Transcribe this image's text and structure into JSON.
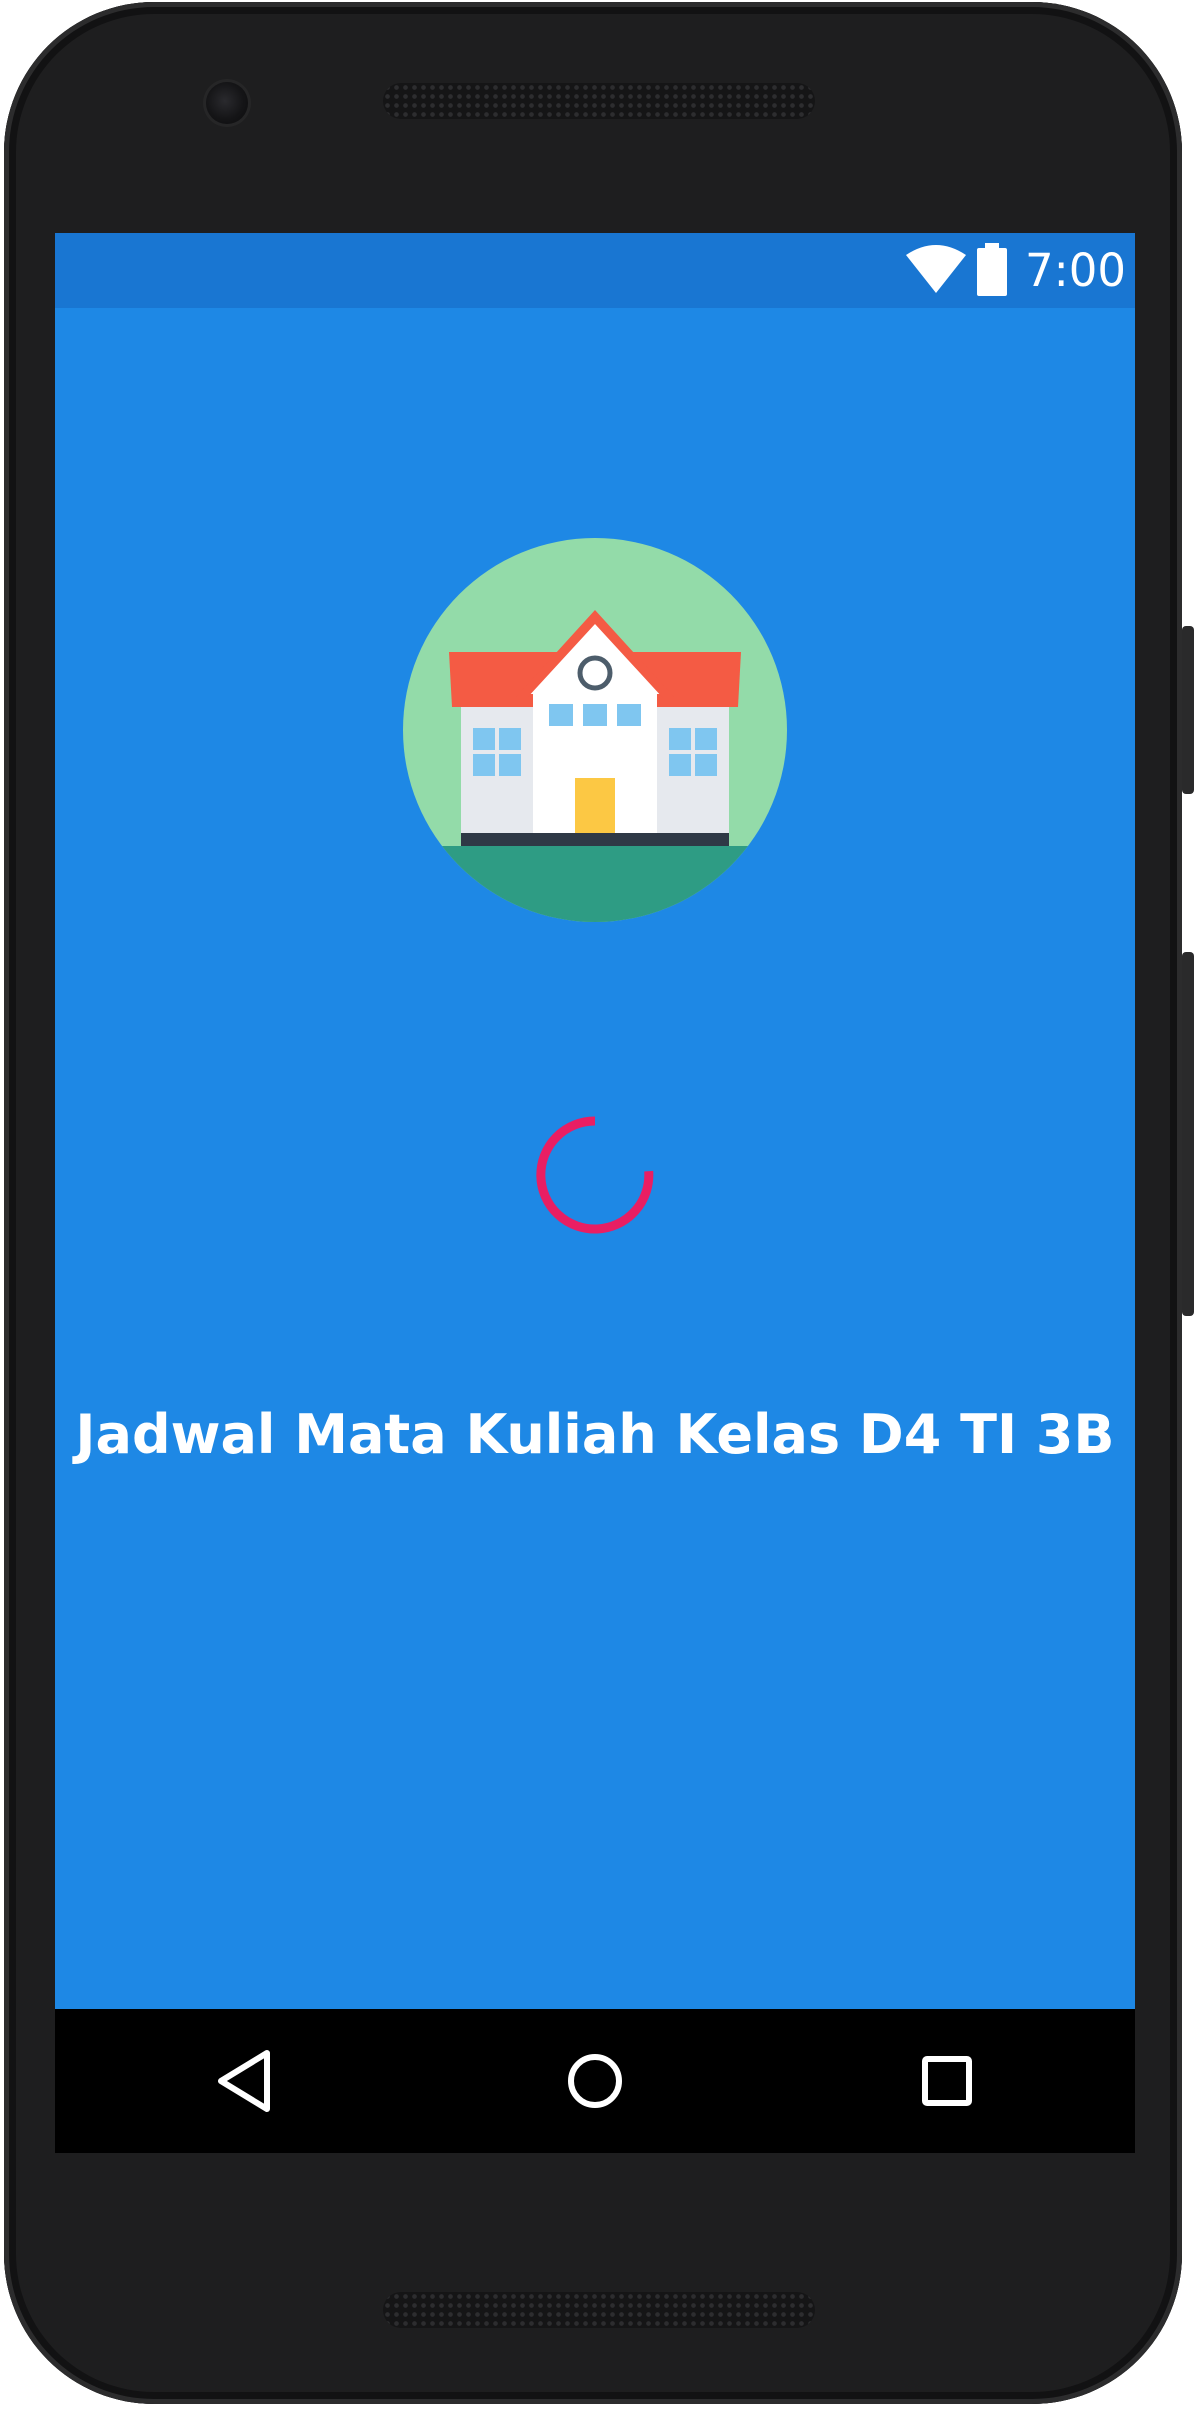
{
  "status_bar": {
    "time": "7:00",
    "icons": [
      "wifi-icon",
      "battery-icon"
    ]
  },
  "splash": {
    "logo_icon": "school-building-icon",
    "loading_indicator": "circular-progress-spinner",
    "title": "Jadwal Mata Kuliah Kelas D4 TI 3B"
  },
  "navigation_bar": {
    "buttons": [
      "back-icon",
      "home-icon",
      "recents-icon"
    ]
  },
  "colors": {
    "primary": "#1e88e5",
    "primary_dark": "#1976d2",
    "accent": "#e91e63",
    "text": "#ffffff"
  }
}
